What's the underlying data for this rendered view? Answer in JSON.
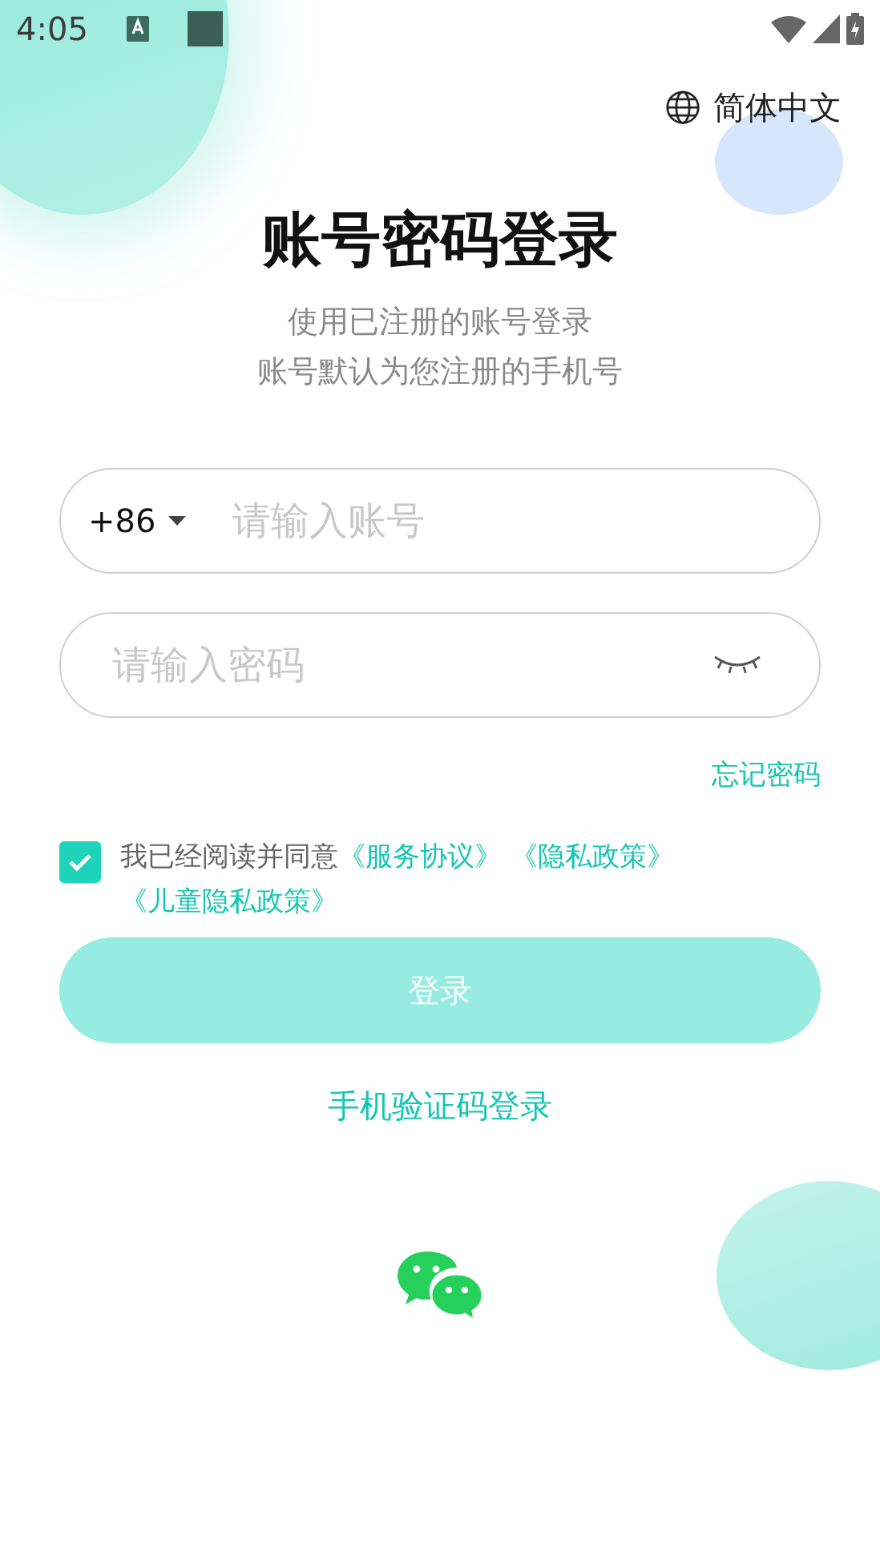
{
  "status_bar": {
    "time": "4:05"
  },
  "language": {
    "label": "简体中文"
  },
  "title": "账号密码登录",
  "subtitle": [
    "使用已注册的账号登录",
    "账号默认为您注册的手机号"
  ],
  "account_field": {
    "country_code": "+86",
    "placeholder": "请输入账号"
  },
  "password_field": {
    "placeholder": "请输入密码",
    "visible": false
  },
  "forgot_link": "忘记密码",
  "agreement": {
    "checked": true,
    "text": "我已经阅读并同意",
    "links": [
      "《服务协议》",
      "《隐私政策》",
      "《儿童隐私政策》"
    ]
  },
  "login_button": {
    "label": "登录",
    "disabled": true
  },
  "sms_login_link": "手机验证码登录"
}
